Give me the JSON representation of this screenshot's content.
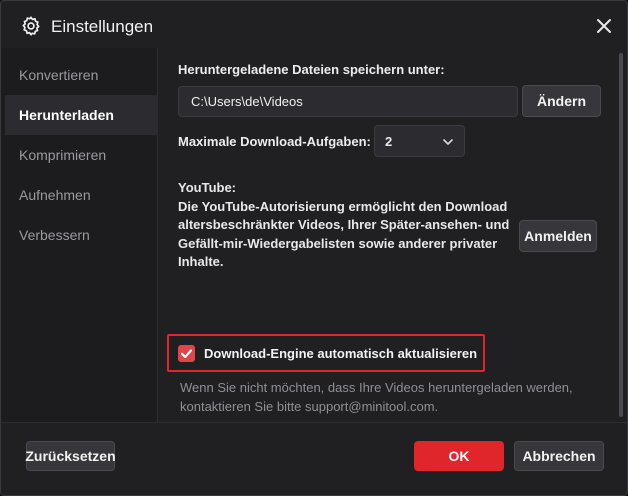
{
  "window": {
    "title": "Einstellungen",
    "icon": "gear-icon",
    "close_icon": "close-icon"
  },
  "sidebar": {
    "items": [
      {
        "label": "Konvertieren",
        "active": false
      },
      {
        "label": "Herunterladen",
        "active": true
      },
      {
        "label": "Komprimieren",
        "active": false
      },
      {
        "label": "Aufnehmen",
        "active": false
      },
      {
        "label": "Verbessern",
        "active": false
      }
    ]
  },
  "download": {
    "save_label": "Heruntergeladene Dateien speichern unter:",
    "save_path": "C:\\Users\\de\\Videos",
    "change_button": "Ändern",
    "max_tasks_label": "Maximale Download-Aufgaben:",
    "max_tasks_value": "2",
    "youtube_title": "YouTube:",
    "youtube_lines": [
      "Die YouTube-Autorisierung ermöglicht den Download",
      "altersbeschränkter Videos, Ihrer Später-ansehen- und",
      "Gefällt-mir-Wiedergabelisten sowie anderer privater",
      "Inhalte."
    ],
    "login_button": "Anmelden",
    "auto_update_label": "Download-Engine automatisch aktualisieren",
    "auto_update_checked": true,
    "info_lines": [
      "Wenn Sie nicht möchten, dass Ihre Videos heruntergeladen werden,",
      "kontaktieren Sie bitte support@minitool.com."
    ]
  },
  "footer": {
    "reset_button": "Zurücksetzen",
    "ok_button": "OK",
    "cancel_button": "Abbrechen"
  },
  "colors": {
    "accent": "#e0252b",
    "background": "#202023",
    "sidebar_active": "#2b2b30"
  }
}
